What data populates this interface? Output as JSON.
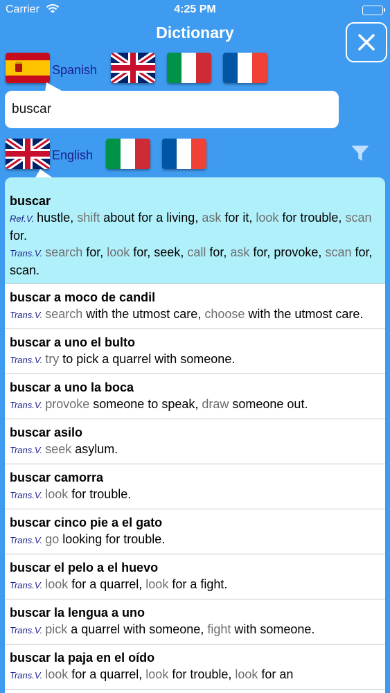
{
  "status_bar": {
    "carrier": "Carrier",
    "time": "4:25 PM"
  },
  "header": {
    "title": "Dictionary",
    "close_icon": "close-icon"
  },
  "source_languages": {
    "selected_label": "Spanish",
    "flags": [
      "spain-flag-icon",
      "uk-flag-icon",
      "italy-flag-icon",
      "france-flag-icon"
    ]
  },
  "search": {
    "value": "buscar",
    "placeholder": ""
  },
  "target_languages": {
    "selected_label": "English",
    "flags": [
      "uk-flag-icon",
      "italy-flag-icon",
      "france-flag-icon"
    ],
    "filter_icon": "filter-icon"
  },
  "colors": {
    "background": "#3f9bf0",
    "selected_row": "#b0f0fa",
    "tag": "#1b1f8c",
    "link_word": "#6e6e6e"
  },
  "results": [
    {
      "headword": "buscar",
      "lines": [
        {
          "tag": "Ref.V.",
          "parts": [
            [
              "hustle, ",
              false
            ],
            [
              "shift",
              true
            ],
            [
              " about for a living, ",
              false
            ],
            [
              "ask",
              true
            ],
            [
              " for it, ",
              false
            ],
            [
              "look",
              true
            ],
            [
              " for trouble, ",
              false
            ],
            [
              "scan",
              true
            ],
            [
              " for.",
              false
            ]
          ]
        },
        {
          "tag": "Trans.V.",
          "parts": [
            [
              "search",
              true
            ],
            [
              " for, ",
              false
            ],
            [
              "look",
              true
            ],
            [
              " for, seek, ",
              false
            ],
            [
              "call",
              true
            ],
            [
              " for, ",
              false
            ],
            [
              "ask",
              true
            ],
            [
              " for, provoke, ",
              false
            ],
            [
              "scan",
              true
            ],
            [
              " for, scan.",
              false
            ]
          ]
        }
      ]
    },
    {
      "headword": "buscar a moco de candil",
      "lines": [
        {
          "tag": "Trans.V.",
          "parts": [
            [
              "search",
              true
            ],
            [
              " with the utmost care, ",
              false
            ],
            [
              "choose",
              true
            ],
            [
              " with the utmost care.",
              false
            ]
          ]
        }
      ]
    },
    {
      "headword": "buscar a uno el bulto",
      "lines": [
        {
          "tag": "Trans.V.",
          "parts": [
            [
              "try",
              true
            ],
            [
              " to pick a quarrel with someone.",
              false
            ]
          ]
        }
      ]
    },
    {
      "headword": "buscar a uno la boca",
      "lines": [
        {
          "tag": "Trans.V.",
          "parts": [
            [
              "provoke",
              true
            ],
            [
              " someone to speak, ",
              false
            ],
            [
              "draw",
              true
            ],
            [
              " someone out.",
              false
            ]
          ]
        }
      ]
    },
    {
      "headword": "buscar asilo",
      "lines": [
        {
          "tag": "Trans.V.",
          "parts": [
            [
              "seek",
              true
            ],
            [
              " asylum.",
              false
            ]
          ]
        }
      ]
    },
    {
      "headword": "buscar camorra",
      "lines": [
        {
          "tag": "Trans.V.",
          "parts": [
            [
              "look",
              true
            ],
            [
              " for trouble.",
              false
            ]
          ]
        }
      ]
    },
    {
      "headword": "buscar cinco pie a el gato",
      "lines": [
        {
          "tag": "Trans.V.",
          "parts": [
            [
              "go",
              true
            ],
            [
              " looking for trouble.",
              false
            ]
          ]
        }
      ]
    },
    {
      "headword": "buscar el pelo a el huevo",
      "lines": [
        {
          "tag": "Trans.V.",
          "parts": [
            [
              "look",
              true
            ],
            [
              " for a quarrel, ",
              false
            ],
            [
              "look",
              true
            ],
            [
              " for a fight.",
              false
            ]
          ]
        }
      ]
    },
    {
      "headword": "buscar la lengua a uno",
      "lines": [
        {
          "tag": "Trans.V.",
          "parts": [
            [
              "pick",
              true
            ],
            [
              " a quarrel with someone, ",
              false
            ],
            [
              "fight",
              true
            ],
            [
              " with someone.",
              false
            ]
          ]
        }
      ]
    },
    {
      "headword": "buscar la paja en el oído",
      "lines": [
        {
          "tag": "Trans.V.",
          "parts": [
            [
              "look",
              true
            ],
            [
              " for a quarrel, ",
              false
            ],
            [
              "look",
              true
            ],
            [
              " for trouble, ",
              false
            ],
            [
              "look",
              true
            ],
            [
              " for an",
              false
            ]
          ]
        }
      ]
    }
  ]
}
